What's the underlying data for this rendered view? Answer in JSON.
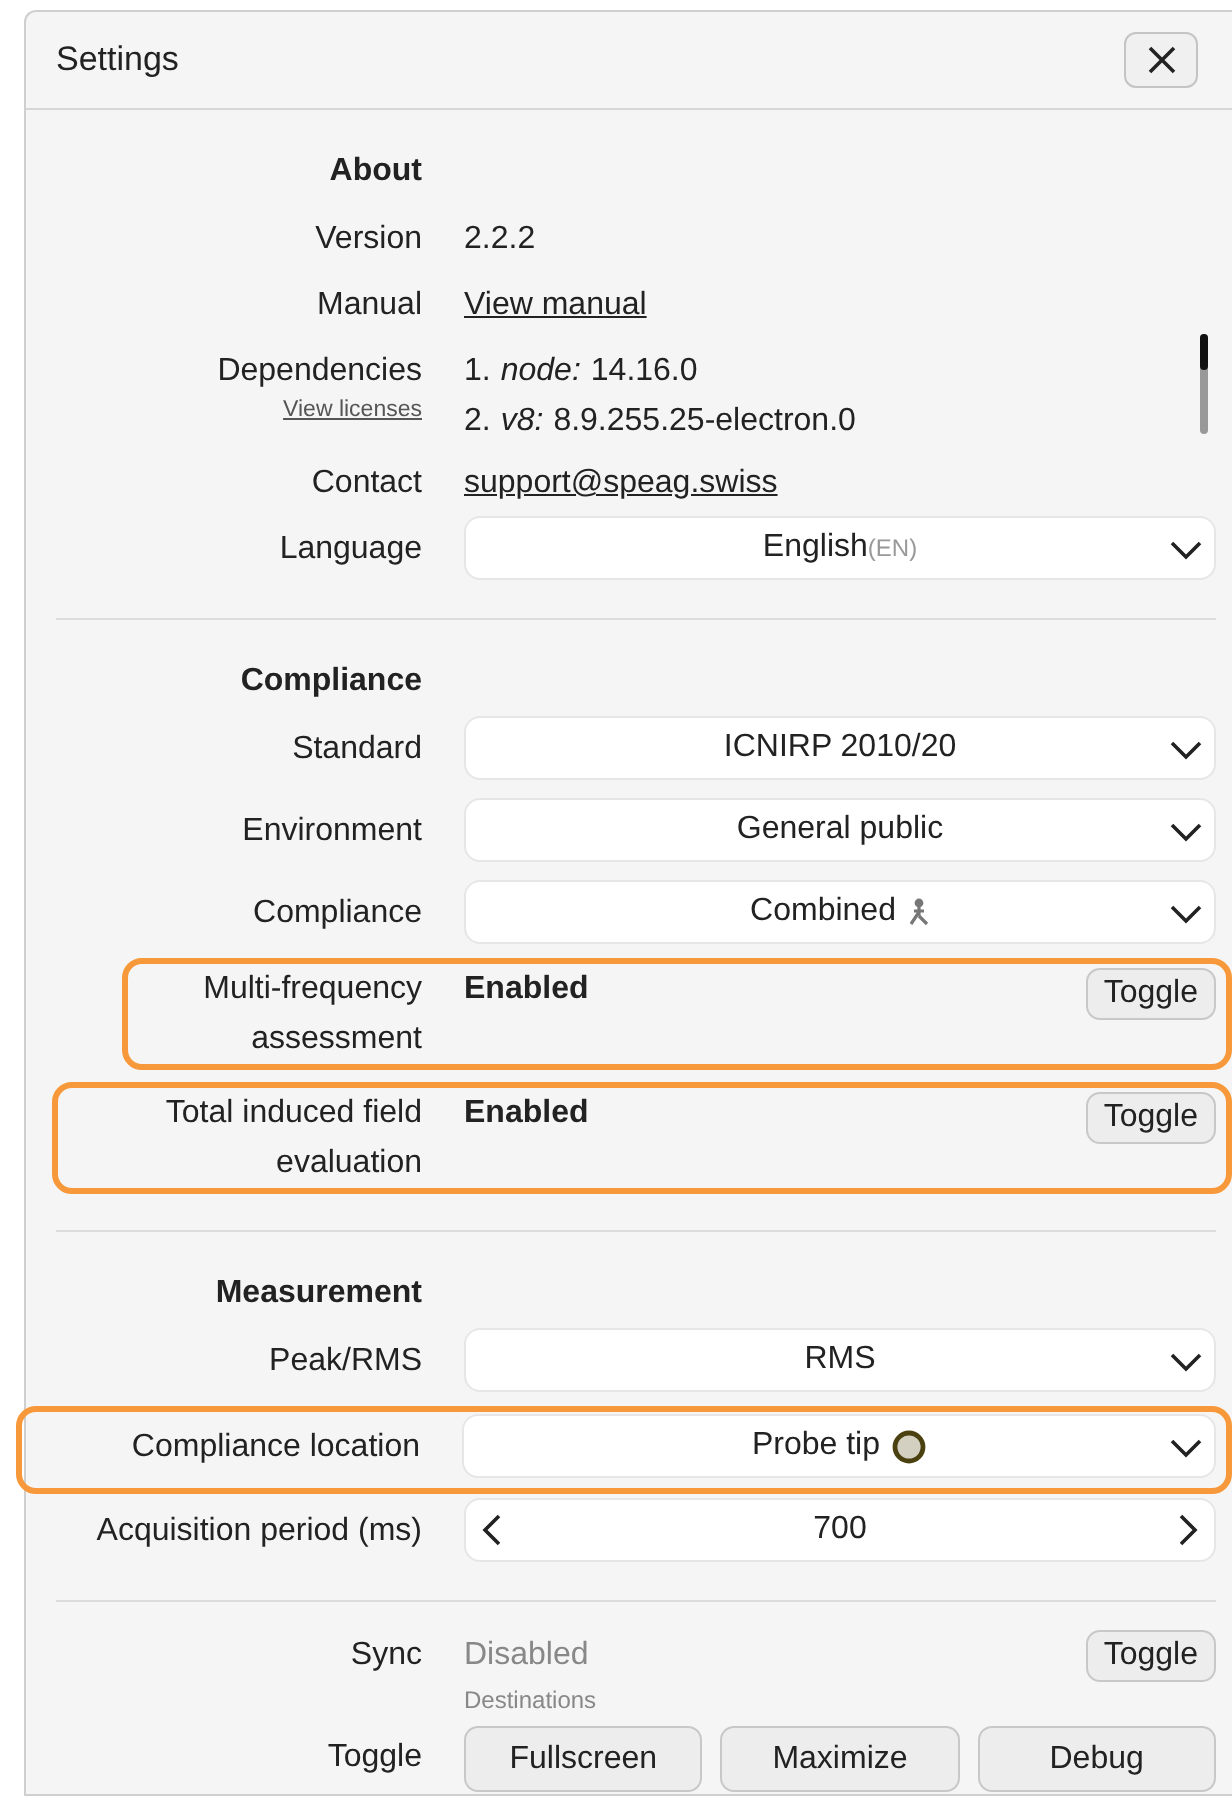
{
  "window": {
    "title": "Settings"
  },
  "sections": [
    {
      "heading": "About",
      "rows": [
        {
          "kind": "text",
          "label": "Version",
          "value": "2.2.2",
          "highlighted": false
        },
        {
          "kind": "link",
          "label": "Manual",
          "value": "View manual",
          "highlighted": false
        },
        {
          "kind": "deps",
          "label": "Dependencies",
          "sublink": "View licenses",
          "items": [
            {
              "number": "1.",
              "name": "node:",
              "version": "14.16.0"
            },
            {
              "number": "2.",
              "name": "v8:",
              "version": "8.9.255.25-electron.0"
            }
          ],
          "highlighted": false
        },
        {
          "kind": "link",
          "label": "Contact",
          "value": "support@speag.swiss",
          "highlighted": false
        },
        {
          "kind": "select",
          "label": "Language",
          "value": "English",
          "suffix": "(EN)",
          "highlighted": false
        }
      ]
    },
    {
      "heading": "Compliance",
      "rows": [
        {
          "kind": "select",
          "label": "Standard",
          "value": "ICNIRP 2010/20",
          "highlighted": false
        },
        {
          "kind": "select",
          "label": "Environment",
          "value": "General public",
          "highlighted": false
        },
        {
          "kind": "select-figure",
          "label": "Compliance",
          "value": "Combined",
          "highlighted": false
        },
        {
          "kind": "toggle",
          "label": "Multi-frequency assessment",
          "value": "Enabled",
          "enabled": true,
          "button": "Toggle",
          "highlighted": true
        },
        {
          "kind": "toggle",
          "label": "Total induced field evaluation",
          "value": "Enabled",
          "enabled": true,
          "button": "Toggle",
          "highlighted": true
        }
      ]
    },
    {
      "heading": "Measurement",
      "rows": [
        {
          "kind": "select",
          "label": "Peak/RMS",
          "value": "RMS",
          "highlighted": false
        },
        {
          "kind": "select-dot",
          "label": "Compliance location",
          "value": "Probe tip",
          "highlighted": true
        },
        {
          "kind": "stepper",
          "label": "Acquisition period (ms)",
          "value": "700",
          "highlighted": false
        }
      ]
    },
    {
      "rows": [
        {
          "kind": "toggle",
          "label": "Sync",
          "value": "Disabled",
          "enabled": false,
          "note": "Destinations",
          "button": "Toggle",
          "highlighted": false
        },
        {
          "kind": "buttons",
          "label": "Toggle",
          "buttons": [
            "Fullscreen",
            "Maximize",
            "Debug"
          ],
          "highlighted": false
        }
      ]
    }
  ]
}
